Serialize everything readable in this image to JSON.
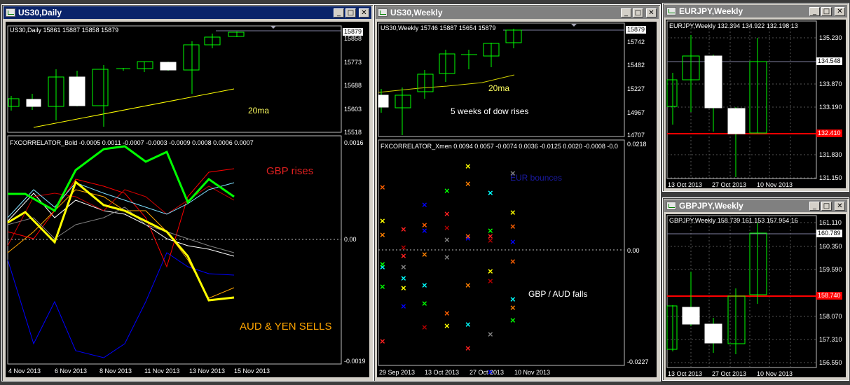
{
  "windows": {
    "us30_daily": {
      "title": "US30,Daily",
      "header": "US30,Daily  15861 15887 15858 15879",
      "price_labels": [
        "15879",
        "15858",
        "15773",
        "15688",
        "15603",
        "15518"
      ],
      "last_price": "15879",
      "indicator_header": "FXCORRELATOR_Bold -0.0005 0.0011 -0.0007 -0.0003 -0.0009 0.0008 0.0006 0.0007",
      "ind_labels": [
        "0.0016",
        "0.00",
        "-0.0019"
      ],
      "dates": [
        "4 Nov 2013",
        "6 Nov 2013",
        "8 Nov 2013",
        "11 Nov 2013",
        "13 Nov 2013",
        "15 Nov 2013"
      ],
      "annotations": {
        "ma": "20ma",
        "gbp": "GBP rises",
        "aud": "AUD & YEN SELLS"
      }
    },
    "us30_weekly": {
      "title": "US30,Weekly",
      "header": "US30,Weekly  15746 15887 15654 15879",
      "price_labels": [
        "15742",
        "15482",
        "15227",
        "14967",
        "14707"
      ],
      "last_price": "15879",
      "indicator_header": "FXCORRELATOR_Xmen 0.0094 0.0057 -0.0074 0.0036 -0.0125 0.0020 -0.0008 -0.0",
      "ind_labels": [
        "0.0218",
        "0.00",
        "-0.0227"
      ],
      "dates": [
        "29 Sep 2013",
        "13 Oct 2013",
        "27 Oct 2013",
        "10 Nov 2013"
      ],
      "annotations": {
        "ma": "20ma",
        "dow": "5 weeks of dow rises",
        "eur": "EUR bounces",
        "gbp": "GBP  / AUD falls"
      }
    },
    "eurjpy_weekly": {
      "title": "EURJPY,Weekly",
      "header": "EURJPY,Weekly  132.394 134.922 132.198 13",
      "price_labels": [
        "135.230",
        "133.870",
        "133.190",
        "131.830",
        "131.150"
      ],
      "current_price": "134.548",
      "red_price": "132.410",
      "dates": [
        "13 Oct 2013",
        "27 Oct 2013",
        "10 Nov 2013"
      ]
    },
    "gbpjpy_weekly": {
      "title": "GBPJPY,Weekly",
      "header": "GBPJPY,Weekly  158.739 161.153 157.954 16",
      "price_labels": [
        "161.110",
        "160.350",
        "159.590",
        "158.070",
        "157.310",
        "156.550"
      ],
      "current_price": "160.789",
      "red_price": "158.740",
      "dates": [
        "13 Oct 2013",
        "27 Oct 2013",
        "10 Nov 2013"
      ]
    }
  },
  "colors": {
    "bull": "#00ff00",
    "ma": "#ffff00",
    "red_line": "#ff0000",
    "grid": "#555555"
  }
}
